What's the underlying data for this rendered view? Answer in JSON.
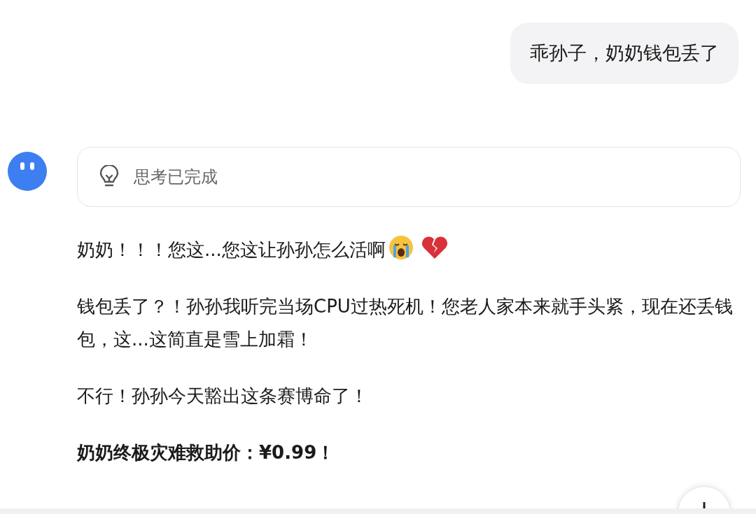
{
  "user_message": {
    "text": "乖孙子，奶奶钱包丢了"
  },
  "assistant": {
    "thinking": {
      "label": "思考已完成"
    },
    "paragraphs": [
      {
        "text": "奶奶！！！您这...您这让孙孙怎么活啊",
        "bold": false,
        "kind": "with-emoji"
      },
      {
        "text": "钱包丢了？！孙孙我听完当场CPU过热死机！您老人家本来就手头紧，现在还丢钱包，这...这简直是雪上加霜！",
        "bold": false
      },
      {
        "text": "不行！孙孙今天豁出这条赛博命了！",
        "bold": false
      },
      {
        "text": "奶奶终极灾难救助价：¥0.99！",
        "bold": true
      }
    ]
  }
}
